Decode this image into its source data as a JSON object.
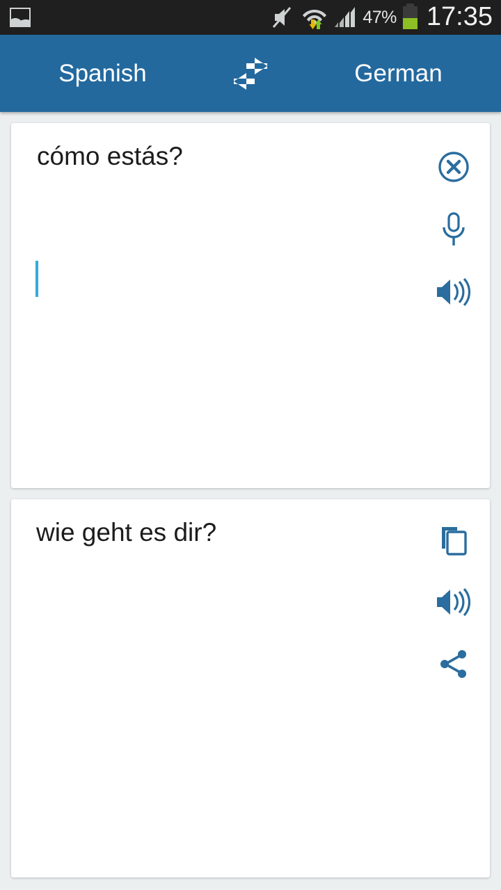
{
  "status_bar": {
    "notification_icons": [
      "photo-icon"
    ],
    "system_icons": [
      "volume-mute-icon",
      "wifi-data-icon",
      "signal-bars-icon"
    ],
    "battery_percent_label": "47%",
    "battery_level": 47,
    "clock": "17:35",
    "background_color": "#1f1f1f",
    "text_color": "#f2f2f2",
    "battery_fill_color": "#8cc024",
    "data_down_color": "#e6b800",
    "data_up_color": "#7ec820"
  },
  "header": {
    "source_language": "Spanish",
    "target_language": "German",
    "swap_icon": "swap-horizontal-icon",
    "background_color": "#23699e",
    "text_color": "#ffffff"
  },
  "source_card": {
    "text": "cómo estás?",
    "cursor_visible": true,
    "cursor_color": "#33aadd",
    "actions": [
      {
        "name": "clear-text-button",
        "icon": "close-circle-icon"
      },
      {
        "name": "voice-input-button",
        "icon": "microphone-icon"
      },
      {
        "name": "speak-source-button",
        "icon": "speaker-icon"
      }
    ]
  },
  "target_card": {
    "text": "wie geht es dir?",
    "actions": [
      {
        "name": "copy-translation-button",
        "icon": "copy-icon"
      },
      {
        "name": "speak-translation-button",
        "icon": "speaker-icon"
      },
      {
        "name": "share-translation-button",
        "icon": "share-icon"
      }
    ]
  },
  "theme": {
    "page_background": "#eceff0",
    "card_background": "#ffffff",
    "accent_blue": "#23699e",
    "icon_blue": "#2a6d9e",
    "body_text": "#1c1c1c"
  }
}
